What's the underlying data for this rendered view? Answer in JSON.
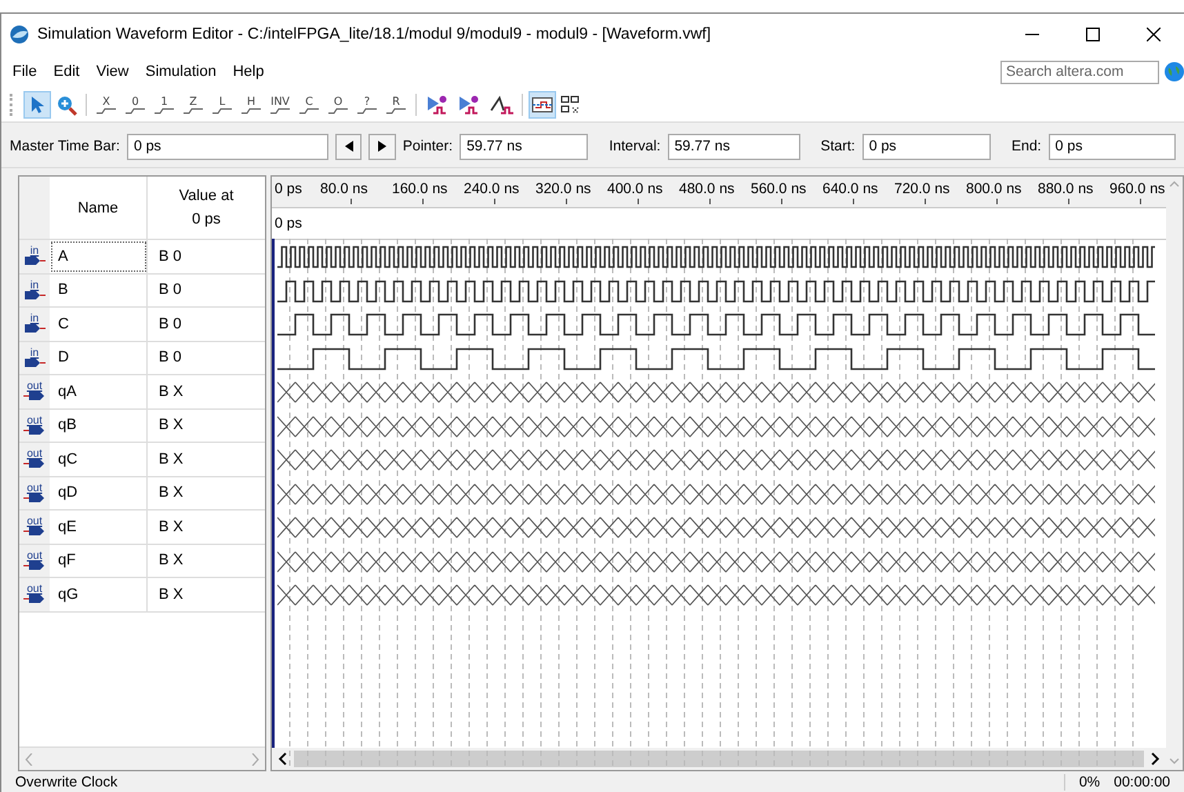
{
  "window": {
    "title": "Simulation Waveform Editor - C:/intelFPGA_lite/18.1/modul 9/modul9 - modul9 - [Waveform.vwf]"
  },
  "menu": [
    "File",
    "Edit",
    "View",
    "Simulation",
    "Help"
  ],
  "search": {
    "placeholder": "Search altera.com"
  },
  "toolbar": [
    {
      "kind": "pointer",
      "selected": true
    },
    {
      "kind": "zoom",
      "selected": false
    },
    {
      "kind": "value",
      "label": "X",
      "selected": false
    },
    {
      "kind": "value",
      "label": "0",
      "selected": false
    },
    {
      "kind": "value",
      "label": "1",
      "selected": false
    },
    {
      "kind": "value",
      "label": "Z",
      "selected": false
    },
    {
      "kind": "value",
      "label": "L",
      "selected": false
    },
    {
      "kind": "value",
      "label": "H",
      "selected": false
    },
    {
      "kind": "value",
      "label": "INV",
      "selected": false
    },
    {
      "kind": "value",
      "label": "C",
      "selected": false
    },
    {
      "kind": "value",
      "label": "O",
      "selected": false
    },
    {
      "kind": "value",
      "label": "?",
      "selected": false
    },
    {
      "kind": "value",
      "label": "R",
      "selected": false
    },
    {
      "kind": "run",
      "selected": false
    },
    {
      "kind": "run",
      "selected": false
    },
    {
      "kind": "wave",
      "selected": false
    },
    {
      "kind": "snap",
      "selected": true
    },
    {
      "kind": "grid",
      "selected": false
    }
  ],
  "time_bar": {
    "master_label": "Master Time Bar:",
    "master_value": "0 ps",
    "pointer_label": "Pointer:",
    "pointer_value": "59.77 ns",
    "interval_label": "Interval:",
    "interval_value": "59.77 ns",
    "start_label": "Start:",
    "start_value": "0 ps",
    "end_label": "End:",
    "end_value": "0 ps"
  },
  "columns": {
    "name": "Name",
    "value": "Value at",
    "value_sub": "0 ps"
  },
  "ruler": [
    "0 ps",
    "80.0 ns",
    "160.0 ns",
    "240.0 ns",
    "320.0 ns",
    "400.0 ns",
    "480.0 ns",
    "560.0 ns",
    "640.0 ns",
    "720.0 ns",
    "800.0 ns",
    "880.0 ns",
    "960.0 ns"
  ],
  "marker_label": "0 ps",
  "signals": [
    {
      "kind": "input",
      "badge": "in",
      "name": "A",
      "value": "B 0",
      "selected": true
    },
    {
      "kind": "input",
      "badge": "in",
      "name": "B",
      "value": "B 0",
      "selected": false
    },
    {
      "kind": "input",
      "badge": "in",
      "name": "C",
      "value": "B 0",
      "selected": false
    },
    {
      "kind": "input",
      "badge": "in",
      "name": "D",
      "value": "B 0",
      "selected": false
    },
    {
      "kind": "output",
      "badge": "out",
      "name": "qA",
      "value": "B X",
      "selected": false
    },
    {
      "kind": "output",
      "badge": "out",
      "name": "qB",
      "value": "B X",
      "selected": false
    },
    {
      "kind": "output",
      "badge": "out",
      "name": "qC",
      "value": "B X",
      "selected": false
    },
    {
      "kind": "output",
      "badge": "out",
      "name": "qD",
      "value": "B X",
      "selected": false
    },
    {
      "kind": "output",
      "badge": "out",
      "name": "qE",
      "value": "B X",
      "selected": false
    },
    {
      "kind": "output",
      "badge": "out",
      "name": "qF",
      "value": "B X",
      "selected": false
    },
    {
      "kind": "output",
      "badge": "out",
      "name": "qG",
      "value": "B X",
      "selected": false
    }
  ],
  "status_bar": {
    "message": "Overwrite Clock",
    "progress": "0%",
    "time": "00:00:00"
  }
}
